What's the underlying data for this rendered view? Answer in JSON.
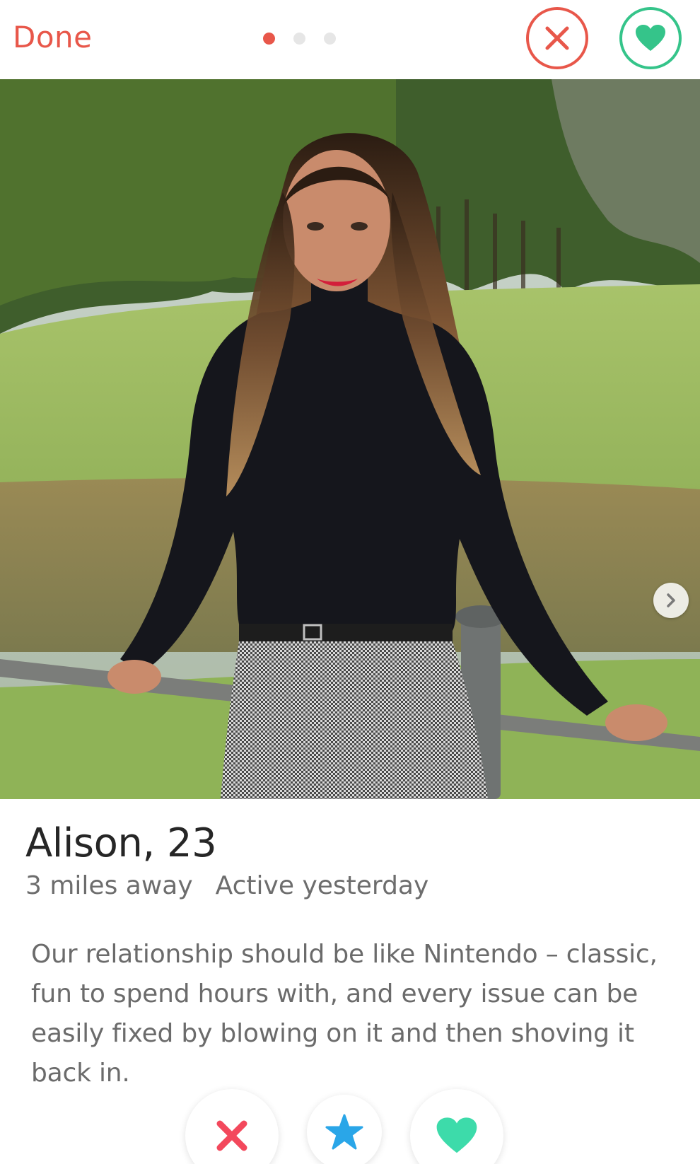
{
  "header": {
    "done_label": "Done",
    "photo_count": 3,
    "active_photo": 1
  },
  "profile": {
    "name_age": "Alison, 23",
    "distance": "3 miles away",
    "activity": "Active yesterday",
    "bio": "Our relationship should be like Nintendo – classic, fun to spend hours with, and every issue can be easily fixed by blowing on it and then shoving it back in."
  },
  "icons": {
    "top_nope": "close-icon",
    "top_like": "heart-icon",
    "next_photo": "chevron-right-icon",
    "nope": "x-icon",
    "super_like": "star-icon",
    "like": "heart-icon"
  },
  "colors": {
    "nope": "#e8574a",
    "like": "#35c48a",
    "super_like": "#2aa6e8",
    "text_primary": "#262626",
    "text_secondary": "#6d6d6d"
  }
}
